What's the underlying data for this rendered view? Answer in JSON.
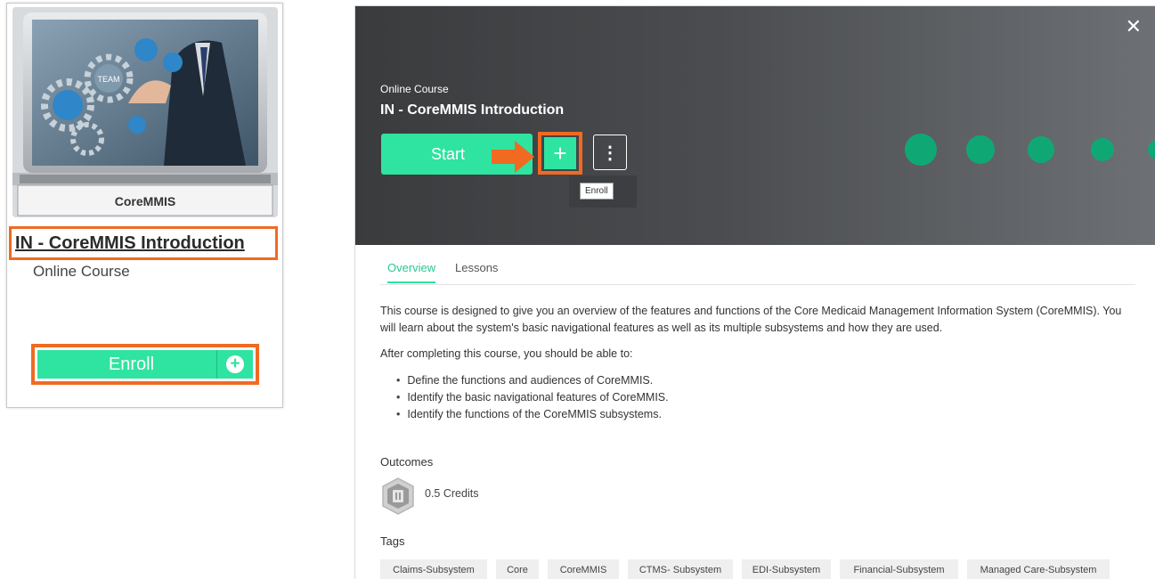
{
  "card": {
    "thumb_logo_text": "TEAM",
    "banner_label": "CoreMMIS",
    "title": "IN - CoreMMIS Introduction",
    "course_type": "Online Course",
    "enroll_label": "Enroll"
  },
  "panel": {
    "close_glyph": "✕",
    "course_type": "Online Course",
    "title": "IN - CoreMMIS Introduction",
    "start_label": "Start",
    "plus_glyph": "+",
    "kebab_glyph": "⋮",
    "tooltip": "Enroll",
    "tabs": [
      {
        "label": "Overview",
        "active": true
      },
      {
        "label": "Lessons",
        "active": false
      }
    ],
    "description": "This course is designed to give you an overview of the features and functions of the Core Medicaid Management Information System (CoreMMIS). You will learn about the system's basic navigational features as well as its multiple subsystems and how they are used.",
    "objectives_intro": "After completing this course, you should be able to:",
    "objectives": [
      "Define the functions and audiences of CoreMMIS.",
      "Identify the basic navigational features of CoreMMIS.",
      "Identify the functions of the CoreMMIS subsystems."
    ],
    "outcomes_heading": "Outcomes",
    "credits": "0.5 Credits",
    "tags_heading": "Tags",
    "tags": [
      "Claims-Subsystem",
      "Core",
      "CoreMMIS",
      "CTMS- Subsystem",
      "EDI-Subsystem",
      "Financial-Subsystem",
      "Managed Care-Subsystem"
    ]
  },
  "colors": {
    "accent_green": "#2fe3a0",
    "highlight_orange": "#f06a22",
    "hero_dark": "#3a3b3d",
    "dot_green": "#0fa874"
  },
  "icons": {
    "close": "close-icon",
    "plus": "plus-icon",
    "kebab": "kebab-menu-icon",
    "credit": "credit-hexagon-icon",
    "arrow": "orange-arrow-icon"
  }
}
